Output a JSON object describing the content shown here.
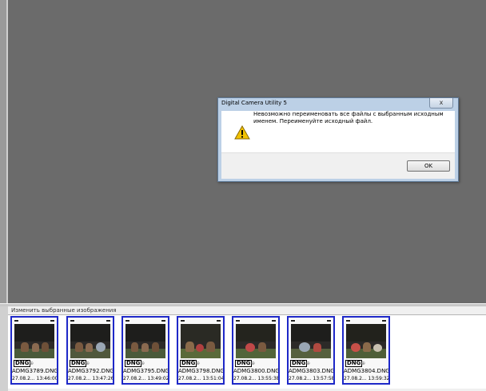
{
  "viewer": {
    "background": "#6b6b6b"
  },
  "strip": {
    "label": "Изменить выбранные изображения",
    "selection_color": "#1e28c8",
    "thumbnails": [
      {
        "badge": "DNG",
        "name": "ADMG3789.DNG",
        "date": "27.08.2... 13:46:00"
      },
      {
        "badge": "DNG",
        "name": "ADMG3792.DNG",
        "date": "27.08.2... 13:47:26"
      },
      {
        "badge": "DNG",
        "name": "ADMG3795.DNG",
        "date": "27.08.2... 13:49:02"
      },
      {
        "badge": "DNG",
        "name": "ADMG3798.DNG",
        "date": "27.08.2... 13:51:04"
      },
      {
        "badge": "DNG",
        "name": "ADMG3800.DNG",
        "date": "27.08.2... 13:55:38"
      },
      {
        "badge": "DNG",
        "name": "ADMG3803.DNG",
        "date": "27.08.2... 13:57:58"
      },
      {
        "badge": "DNG",
        "name": "ADMG3804.DNG",
        "date": "27.08.2... 13:59:32"
      }
    ]
  },
  "dialog": {
    "title": "Digital Camera Utility 5",
    "close_glyph": "x",
    "icon": "warning-icon",
    "message": "Невозможно переименовать все файлы с выбранным исходным именем. Переименуйте исходный файл.",
    "ok_label": "OK"
  }
}
